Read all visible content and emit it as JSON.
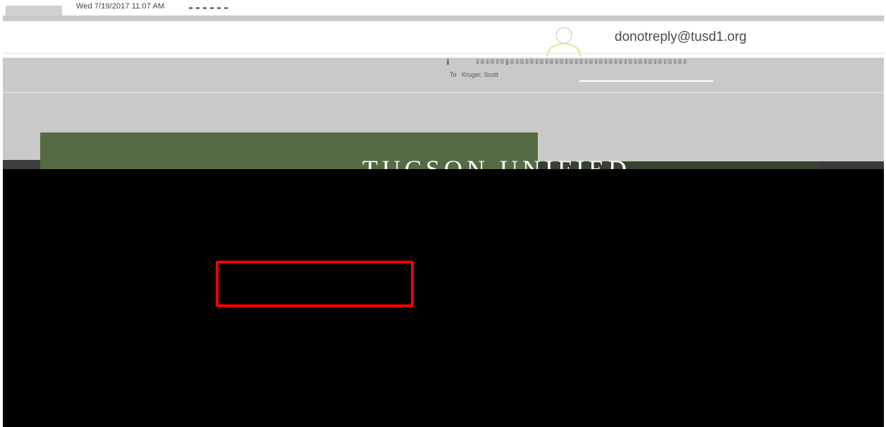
{
  "header": {
    "date_time": "Wed 7/19/2017 11:07 AM",
    "sender": "donotreply@tusd1.org",
    "to_label": "To",
    "recipient": "Kruger, Scott"
  },
  "banner": {
    "logo_text": "TUCSON UNIFIED"
  },
  "colors": {
    "banner_green": "#556b43",
    "highlight_red": "#ff0000"
  },
  "icons": {
    "avatar": "person-avatar-icon"
  }
}
